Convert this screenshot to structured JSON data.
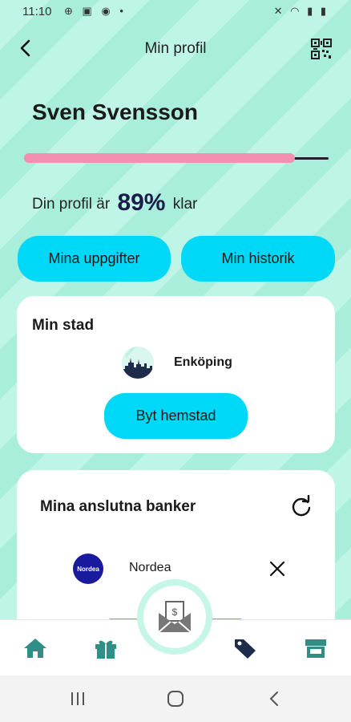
{
  "status_bar": {
    "time": "11:10"
  },
  "header": {
    "title": "Min profil"
  },
  "profile": {
    "name": "Sven Svensson",
    "completion_fraction": 0.89,
    "completion_prefix": "Din profil är",
    "completion_value": "89%",
    "completion_suffix": "klar"
  },
  "buttons": {
    "my_details": "Mina uppgifter",
    "my_history": "Min historik"
  },
  "city_card": {
    "title": "Min stad",
    "city_name": "Enköping",
    "change_button": "Byt hemstad"
  },
  "banks_card": {
    "title": "Mina anslutna banker",
    "banks": [
      {
        "logo_text": "Nordea",
        "name": "Nordea"
      }
    ]
  },
  "bottom_nav": {
    "items": [
      "home-icon",
      "gift-icon",
      "tag-icon",
      "store-icon"
    ],
    "active": "tag-icon",
    "center_action": "envelope-money-icon"
  },
  "colors": {
    "accent_cyan": "#00d8f7",
    "progress_pink": "#f48fb1",
    "background_mint": "#bff5e6",
    "nav_teal": "#2f8f87",
    "nav_active": "#1d2c4a"
  }
}
